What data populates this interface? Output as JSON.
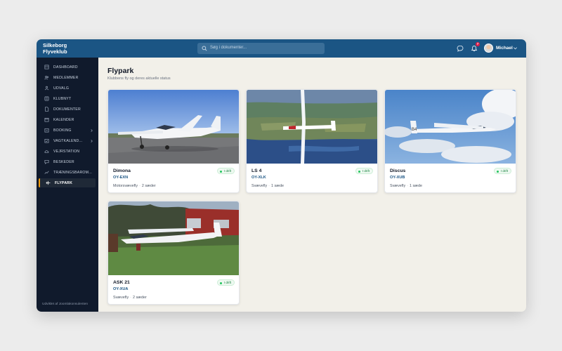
{
  "header": {
    "brand_line1": "Silkeborg",
    "brand_line2": "Flyveklub",
    "search_placeholder": "Søg i dokumenter...",
    "notification_count": "7",
    "user_name": "Michael"
  },
  "sidebar": {
    "items": [
      {
        "label": "DASHBOARD",
        "icon": "home-icon"
      },
      {
        "label": "MEDLEMMER",
        "icon": "users-icon"
      },
      {
        "label": "UDVALG",
        "icon": "group-icon"
      },
      {
        "label": "KLUBNYT",
        "icon": "news-icon"
      },
      {
        "label": "DOKUMENTER",
        "icon": "document-icon"
      },
      {
        "label": "KALENDER",
        "icon": "calendar-icon"
      },
      {
        "label": "BOOKING",
        "icon": "booking-icon"
      },
      {
        "label": "VAGTKALEND...",
        "icon": "shift-calendar-icon"
      },
      {
        "label": "VEJRSTATION",
        "icon": "cloud-icon"
      },
      {
        "label": "BESKEDER",
        "icon": "message-icon"
      },
      {
        "label": "TRÆNINGSBAROM...",
        "icon": "chart-icon"
      },
      {
        "label": "FLYPARK",
        "icon": "plane-icon"
      }
    ],
    "footer": "Udviklet af Joomlakonsulenten"
  },
  "page": {
    "title": "Flypark",
    "subtitle": "Klubbens fly og deres aktuelle status"
  },
  "aircraft": [
    {
      "name": "Dimona",
      "registration": "OY-EXN",
      "type": "Motorsvævefly",
      "seats": "2 sæder",
      "status": "I drift"
    },
    {
      "name": "LS 4",
      "registration": "OY-XLK",
      "type": "Svævefly",
      "seats": "1 sæde",
      "status": "I drift"
    },
    {
      "name": "Discus",
      "registration": "OY-XUB",
      "type": "Svævefly",
      "seats": "1 sæde",
      "status": "I drift"
    },
    {
      "name": "ASK 21",
      "registration": "OY-XUA",
      "type": "Svævefly",
      "seats": "2 sæder",
      "status": "I drift"
    }
  ],
  "colors": {
    "topbar": "#1b5584",
    "sidebar": "#101a2c",
    "active_accent": "#f59e0b",
    "status_green": "#22c55e",
    "content_bg": "#f2f0e9"
  }
}
